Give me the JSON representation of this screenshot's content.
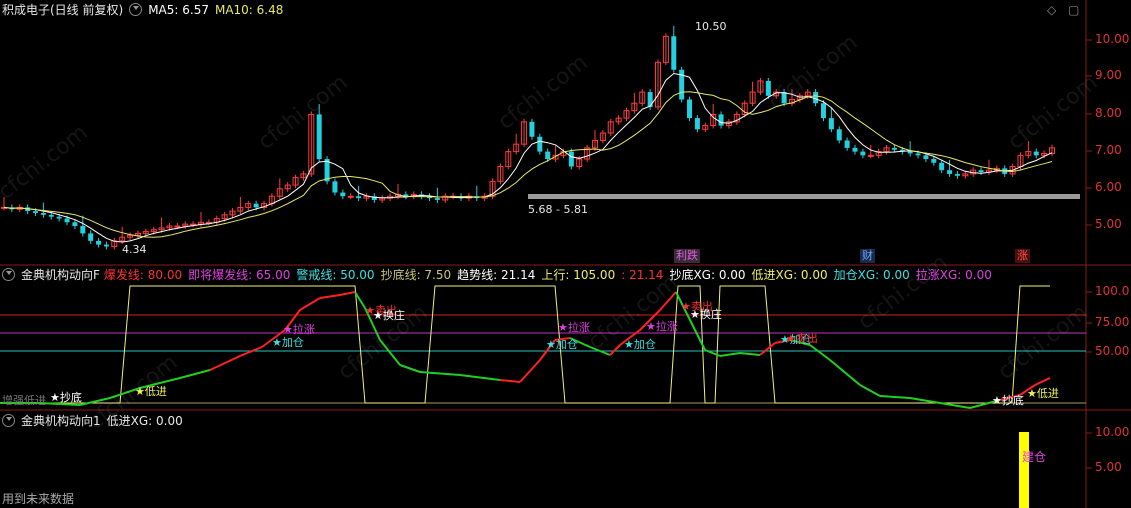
{
  "main_panel": {
    "title": "积成电子(日线 前复权)",
    "ma5_label": "MA5: 6.57",
    "ma10_label": "MA10: 6.48",
    "high_label": "10.50",
    "low_label": "4.34",
    "range_label": "5.68 - 5.81",
    "price_axis": [
      "10.00",
      "9.00",
      "8.00",
      "7.00",
      "6.00",
      "5.00"
    ],
    "event_tags": [
      {
        "text": "利跌",
        "color": "#e060e0"
      },
      {
        "text": "财",
        "color": "#6fa8ff"
      },
      {
        "text": "涨",
        "color": "#ff5050"
      }
    ],
    "colors": {
      "up": "#ff3c3c",
      "down": "#22d0e0",
      "ma5": "#ffffff",
      "ma10": "#e8e86a"
    }
  },
  "indicator_panel": {
    "title": "金典机构动向F",
    "params": [
      {
        "text": "爆发线: 80.00",
        "color": "#ff3030"
      },
      {
        "text": "即将爆发线: 65.00",
        "color": "#e040e0"
      },
      {
        "text": "警戒线: 50.00",
        "color": "#3ce0e0"
      },
      {
        "text": "抄底线: 7.50",
        "color": "#c8c878"
      },
      {
        "text": "趋势线: 21.14",
        "color": "#ffffff"
      },
      {
        "text": "上行: 105.00",
        "color": "#f0f060"
      },
      {
        "text": ": 21.14",
        "color": "#ff3030"
      },
      {
        "text": "抄底XG: 0.00",
        "color": "#ffffff"
      },
      {
        "text": "低进XG: 0.00",
        "color": "#f0f060"
      },
      {
        "text": "加仓XG: 0.00",
        "color": "#3ce0e0"
      },
      {
        "text": "拉涨XG: 0.00",
        "color": "#e040e0"
      }
    ],
    "axis": [
      "100.0",
      "75.00",
      "50.00"
    ],
    "signals": [
      {
        "text": "抄底",
        "color": "#ffffff"
      },
      {
        "text": "低进",
        "color": "#f0f060"
      },
      {
        "text": "加仓",
        "color": "#3ce0e0"
      },
      {
        "text": "拉涨",
        "color": "#e040e0"
      },
      {
        "text": "卖出",
        "color": "#ff3030"
      },
      {
        "text": "换庄",
        "color": "#ffffff"
      },
      {
        "text": "拉涨",
        "color": "#e040e0"
      },
      {
        "text": "加仓",
        "color": "#3ce0e0"
      },
      {
        "text": "加仓",
        "color": "#3ce0e0"
      },
      {
        "text": "拉涨",
        "color": "#e040e0"
      },
      {
        "text": "卖出",
        "color": "#ff3030"
      },
      {
        "text": "换庄",
        "color": "#ffffff"
      },
      {
        "text": "加仓",
        "color": "#3ce0e0"
      },
      {
        "text": "卖出",
        "color": "#ff3030"
      },
      {
        "text": "抄底",
        "color": "#ffffff"
      },
      {
        "text": "低进",
        "color": "#f0f060"
      }
    ],
    "bottom_label": "增强低进"
  },
  "lower_panel": {
    "title": "金典机构动向1",
    "param": "低进XG: 0.00",
    "axis": [
      "10.00",
      "5.00"
    ],
    "build_label": "建仓",
    "footer": "用到未来数据"
  },
  "watermark": "cfchi.com"
}
